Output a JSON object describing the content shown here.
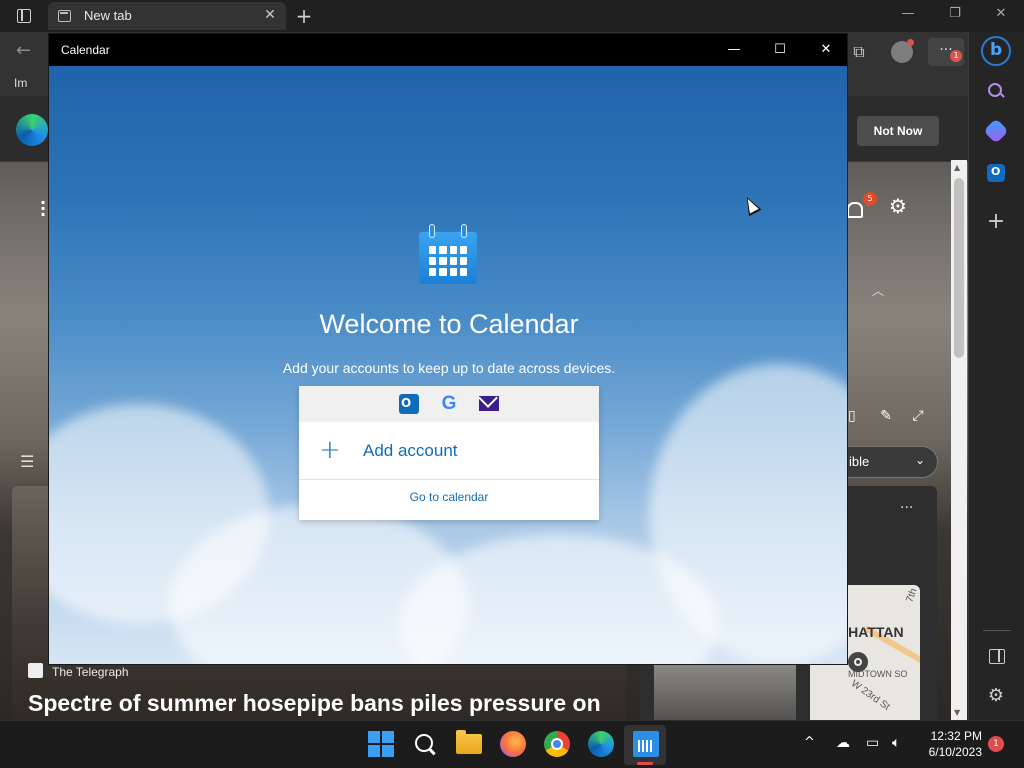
{
  "browser": {
    "tab_label": "New tab",
    "tab_close": "✕",
    "new_tab": "+",
    "window_controls": {
      "minimize": "—",
      "restore": "❐",
      "close": "✕"
    },
    "back": "←",
    "more": "···",
    "more_badge": "1",
    "favorites_label": "Im",
    "banner": {
      "not_now_label": "Not Now"
    },
    "feed": {
      "notification_count": "5",
      "visible_select_label": "ible",
      "card_more": "···",
      "news_source": "The Telegraph",
      "news_headline": "Spectre of summer hosepipe bans piles pressure on",
      "map_label": "NHATTAN",
      "map_label2": "MIDTOWN SO",
      "map_label3": "W 23rd St",
      "map_label4": "7th"
    }
  },
  "calendar": {
    "window_title": "Calendar",
    "controls": {
      "minimize": "—",
      "maximize": "☐",
      "close": "✕"
    },
    "welcome": "Welcome to Calendar",
    "subtitle": "Add your accounts to keep up to date across devices.",
    "providers": [
      "outlook-icon",
      "google-icon",
      "mail-icon"
    ],
    "google_glyph": "G",
    "add_account": "Add account",
    "add_glyph": "+",
    "go_to_calendar": "Go to calendar"
  },
  "taskbar": {
    "tray_chevron": "^",
    "time": "12:32 PM",
    "date": "6/10/2023",
    "notification_badge": "1",
    "apps": [
      "start-icon",
      "search-icon",
      "file-explorer-icon",
      "firefox-icon",
      "chrome-icon",
      "edge-icon",
      "calendar-icon"
    ],
    "accent": "#e34b4b"
  }
}
